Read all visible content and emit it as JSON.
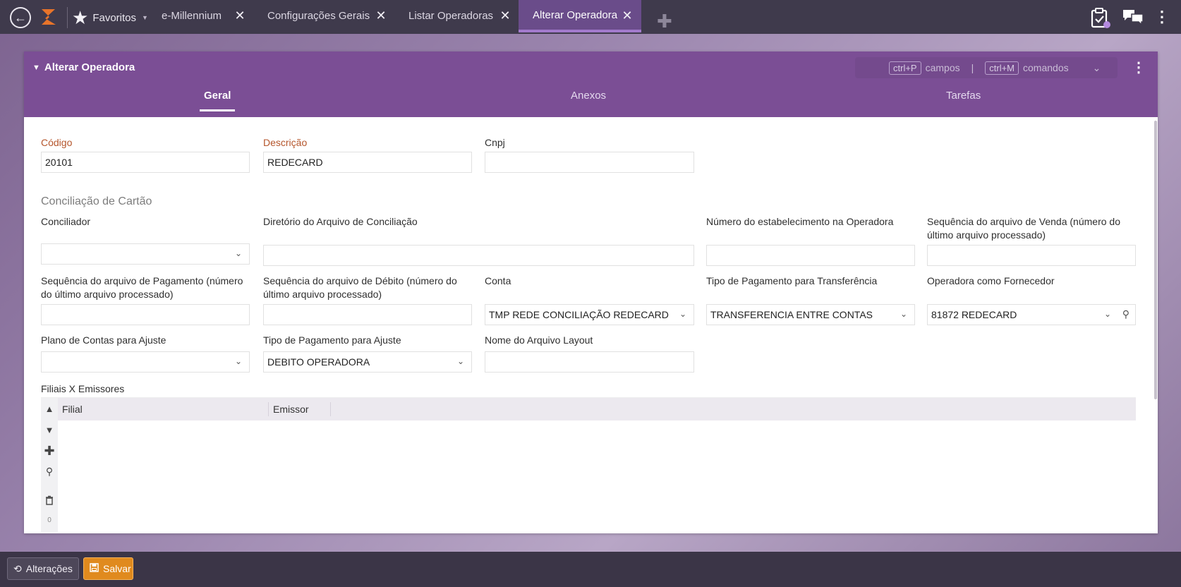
{
  "topbar": {
    "favorites_label": "Favoritos",
    "tabs": [
      {
        "label": "e-Millennium",
        "active": false
      },
      {
        "label": "Configurações Gerais",
        "active": false
      },
      {
        "label": "Listar Operadoras",
        "active": false
      },
      {
        "label": "Alterar Operadora",
        "active": true
      }
    ],
    "icons": {
      "back": "back-arrow-icon",
      "logo": "app-logo-icon",
      "star": "star-icon",
      "close": "close-icon",
      "add": "plus-icon",
      "clipboard": "clipboard-check-icon",
      "chat": "chat-icon",
      "menu": "kebab-menu-icon"
    },
    "colors": {
      "bar": "#3f3a4c",
      "active_tab": "#6a4c8a",
      "logo": "#e8742a"
    }
  },
  "card": {
    "title": "Alterar Operadora",
    "shortcuts": {
      "key1": "ctrl+P",
      "label1": "campos",
      "separator": "|",
      "key2": "ctrl+M",
      "label2": "comandos"
    },
    "tabs": [
      {
        "label": "Geral",
        "active": true
      },
      {
        "label": "Anexos",
        "active": false
      },
      {
        "label": "Tarefas",
        "active": false
      }
    ],
    "header_color": "#7b4e95"
  },
  "form": {
    "codigo": {
      "label": "Código",
      "value": "20101"
    },
    "descricao": {
      "label": "Descrição",
      "value": "REDECARD"
    },
    "cnpj": {
      "label": "Cnpj",
      "value": ""
    },
    "section_title": "Conciliação de Cartão",
    "conciliador": {
      "label": "Conciliador",
      "value": ""
    },
    "diretorio": {
      "label": "Diretório do Arquivo de Conciliação",
      "value": ""
    },
    "numero_estab": {
      "label": "Número do estabelecimento na Operadora",
      "value": ""
    },
    "seq_venda": {
      "label": "Sequência do arquivo de Venda (número do último arquivo processado)",
      "value": ""
    },
    "seq_pagamento": {
      "label": "Sequência do arquivo de Pagamento (número do último arquivo processado)",
      "value": ""
    },
    "seq_debito": {
      "label": "Sequência do arquivo de Débito (número do último arquivo processado)",
      "value": ""
    },
    "conta": {
      "label": "Conta",
      "value": "TMP REDE CONCILIAÇÃO REDECARD"
    },
    "tipo_pag_transf": {
      "label": "Tipo de Pagamento para Transferência",
      "value": "TRANSFERENCIA ENTRE CONTAS"
    },
    "operadora_fornecedor": {
      "label": "Operadora como Fornecedor",
      "value": "81872 REDECARD"
    },
    "plano_contas": {
      "label": "Plano de Contas para Ajuste",
      "value": ""
    },
    "tipo_pag_ajuste": {
      "label": "Tipo de Pagamento para Ajuste",
      "value": "DEBITO OPERADORA"
    },
    "nome_layout": {
      "label": "Nome do Arquivo Layout",
      "value": ""
    }
  },
  "grid": {
    "title": "Filiais X Emissores",
    "columns": [
      "Filial",
      "Emissor"
    ],
    "rows": [],
    "row_count": "0",
    "tool_icons": [
      "sort-up-icon",
      "sort-down-icon",
      "add-icon",
      "search-icon",
      "trash-icon"
    ]
  },
  "footer": {
    "alteracoes_label": "Alterações",
    "salvar_label": "Salvar",
    "colors": {
      "save": "#e08a1e"
    }
  }
}
